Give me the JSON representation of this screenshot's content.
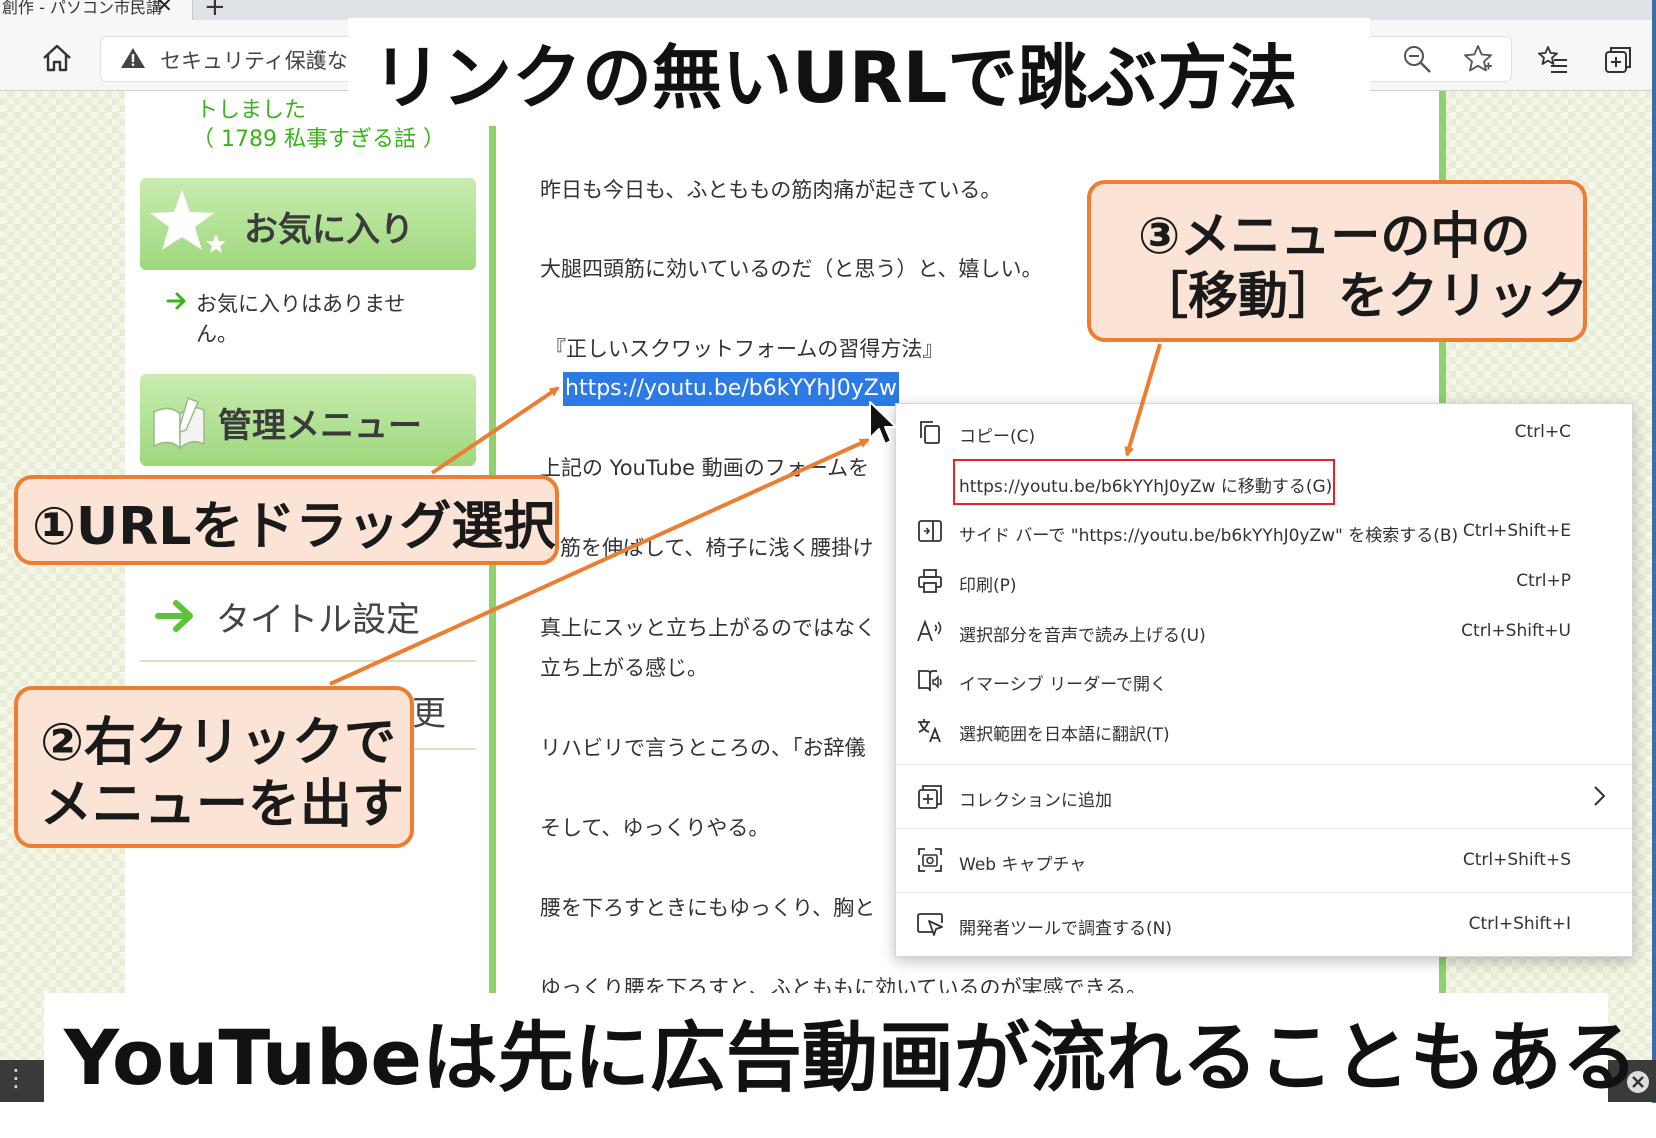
{
  "browser": {
    "tab_title": "創作 - パソコン市民講",
    "tab_close": "✕",
    "new_tab": "+",
    "security_label": "セキュリティ保護なし"
  },
  "title_overlay": "リンクの無いURLで跳ぶ方法",
  "sidebar": {
    "recent_line1": "トしました",
    "recent_line2": "（ 1789 私事すぎる話 ）",
    "favorites_heading": "お気に入り",
    "favorites_empty_1": "お気に入りはありませ",
    "favorites_empty_2": "ん。",
    "admin_heading": "管理メニュー",
    "title_setting": "タイトル設定",
    "partial_glyph": "更"
  },
  "content": {
    "paragraphs": [
      "昨日も今日も、ふとももの筋肉痛が起きている。",
      "大腿四頭筋に効いているのだ（と思う）と、嬉しい。",
      "『正しいスクワットフォームの習得方法』",
      "上記の YouTube 動画のフォームを",
      "筋を伸ばして、椅子に浅く腰掛け",
      "真上にスッと立ち上がるのではなく",
      "立ち上がる感じ。",
      "リハビリで言うところの、「お辞儀",
      "そして、ゆっくりやる。",
      "腰を下ろすときにもゆっくり、胸と",
      "ゆっくり腰を下ろすと、ふとももに効いているのが実感できる。"
    ],
    "selected_url": "https://youtu.be/b6kYYhJ0yZw"
  },
  "context_menu": {
    "items": [
      {
        "label": "コピー(C)",
        "shortcut": "Ctrl+C",
        "icon": "copy-icon"
      },
      {
        "label": "https://youtu.be/b6kYYhJ0yZw に移動する(G)",
        "shortcut": "",
        "icon": ""
      },
      {
        "label": "サイド バーで \"https://youtu.be/b6kYYhJ0yZw\" を検索する(B)",
        "shortcut": "Ctrl+Shift+E",
        "icon": "sidebar-search-icon"
      },
      {
        "label": "印刷(P)",
        "shortcut": "Ctrl+P",
        "icon": "print-icon"
      },
      {
        "label": "選択部分を音声で読み上げる(U)",
        "shortcut": "Ctrl+Shift+U",
        "icon": "read-aloud-icon"
      },
      {
        "label": "イマーシブ リーダーで開く",
        "shortcut": "",
        "icon": "immersive-reader-icon"
      },
      {
        "label": "選択範囲を日本語に翻訳(T)",
        "shortcut": "",
        "icon": "translate-icon"
      },
      {
        "label": "コレクションに追加",
        "shortcut": "",
        "icon": "collections-icon"
      },
      {
        "label": "Web キャプチャ",
        "shortcut": "Ctrl+Shift+S",
        "icon": "web-capture-icon"
      },
      {
        "label": "開発者ツールで調査する(N)",
        "shortcut": "Ctrl+Shift+I",
        "icon": "devtools-icon"
      }
    ]
  },
  "callouts": {
    "step1": "①URLをドラッグ選択",
    "step2_line1": "②右クリックで",
    "step2_line2": "メニューを出す",
    "step3_line1": "③メニューの中の",
    "step3_line2": "［移動］をクリック"
  },
  "bottom_caption": "YouTubeは先に広告動画が流れることもある",
  "colors": {
    "accent_orange": "#ed7d31",
    "callout_fill": "#fbe4d5",
    "selection_blue": "#2c7be5",
    "highlight_red": "#e8202a",
    "sidebar_green": "#3cb21b"
  }
}
